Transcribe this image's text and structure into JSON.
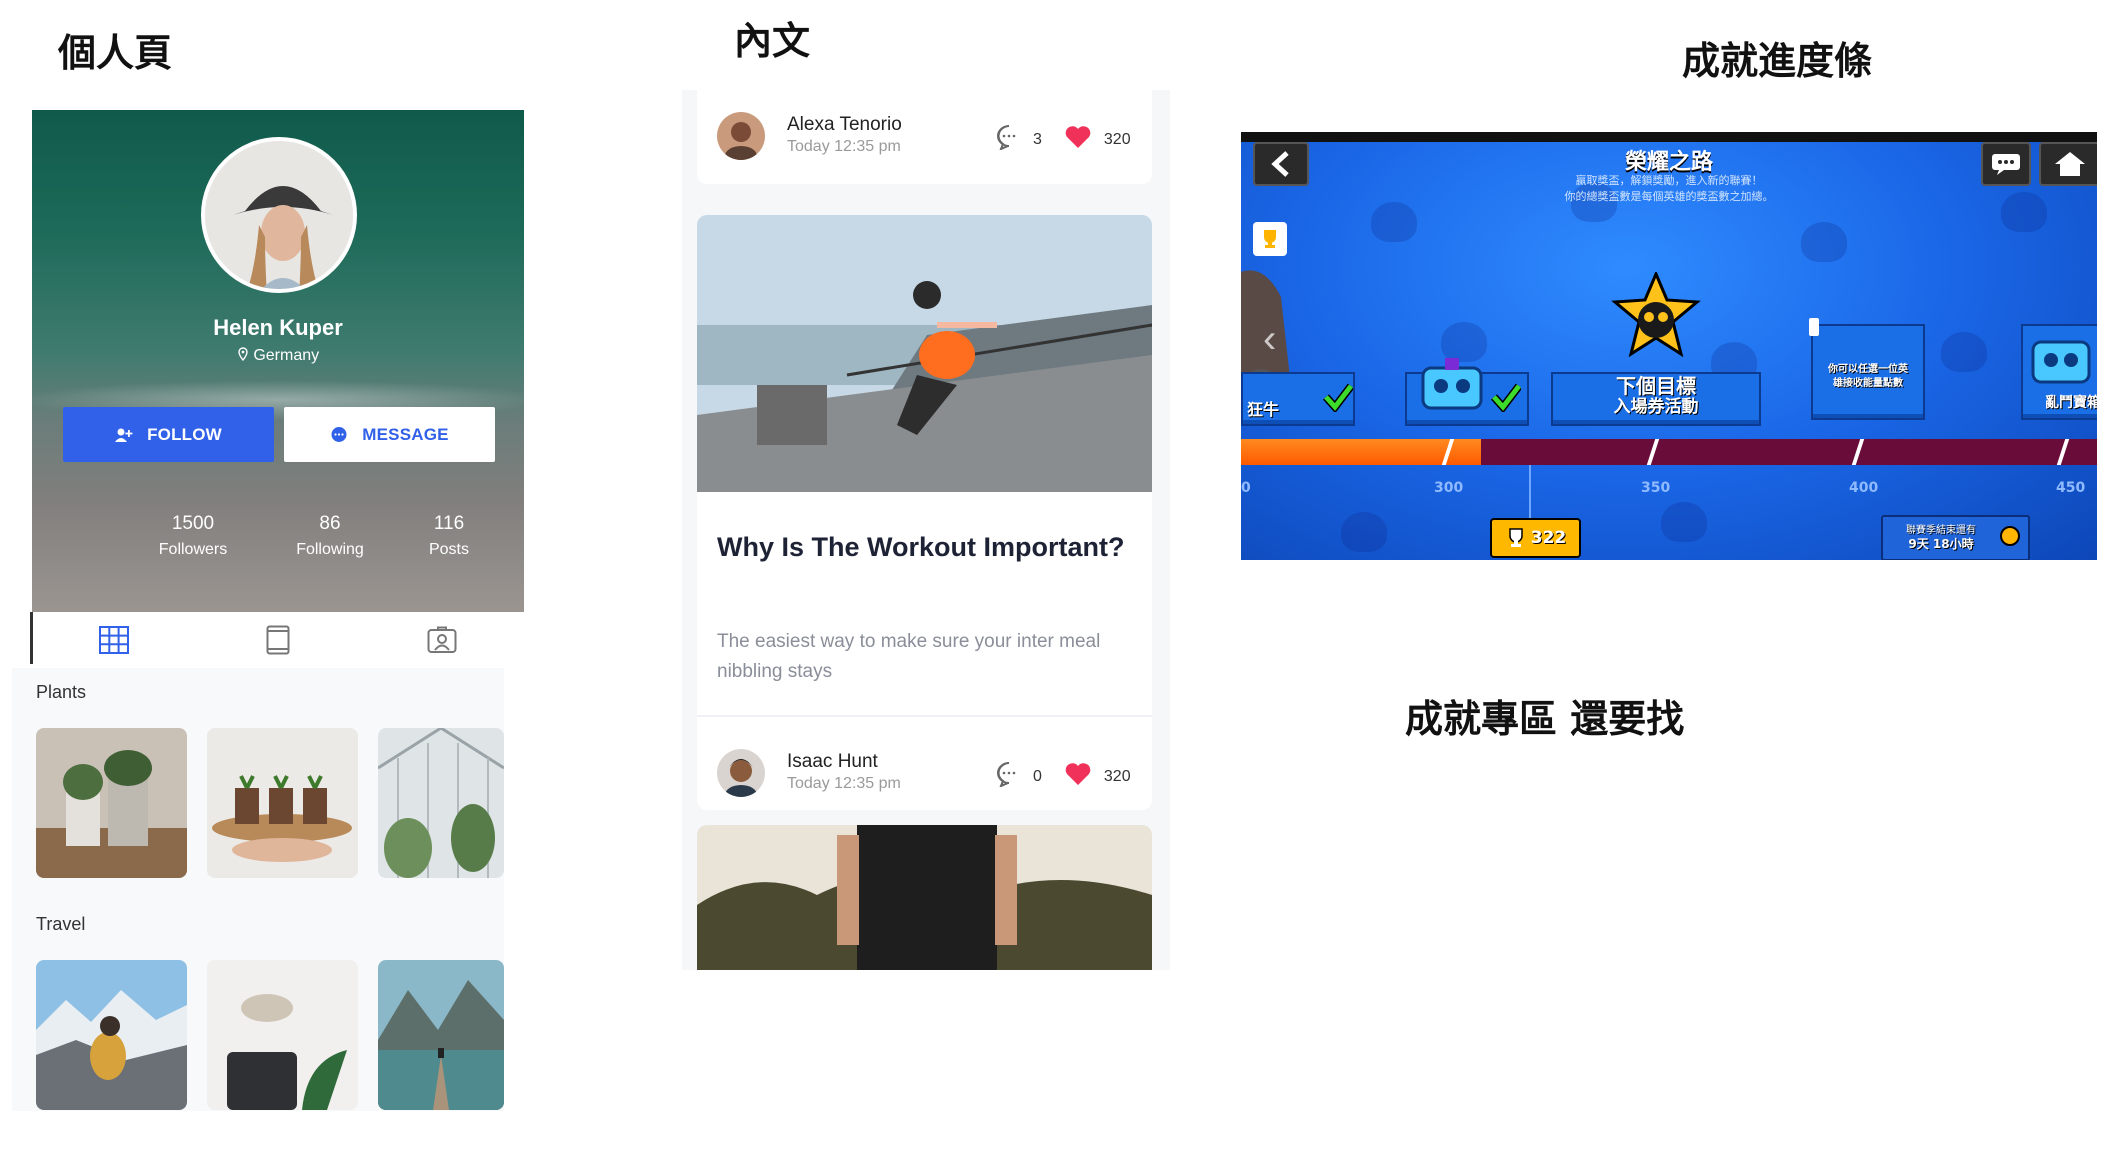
{
  "labels": {
    "profile": "個人頁",
    "content": "內文",
    "progress": "成就進度條",
    "todo": "成就專區 還要找"
  },
  "profile": {
    "name": "Helen Kuper",
    "location": "Germany",
    "follow_label": "FOLLOW",
    "message_label": "MESSAGE",
    "stats": [
      {
        "value": "1500",
        "label": "Followers"
      },
      {
        "value": "86",
        "label": "Following"
      },
      {
        "value": "116",
        "label": "Posts"
      }
    ],
    "tabs": [
      "grid-icon",
      "tablet-icon",
      "contact-card-icon"
    ],
    "categories": [
      {
        "title": "Plants"
      },
      {
        "title": "Travel"
      }
    ],
    "colors": {
      "accent": "#3161e8"
    }
  },
  "feed": {
    "posts": [
      {
        "author": "Alexa Tenorio",
        "time": "Today 12:35 pm",
        "comments": "3",
        "likes": "320"
      },
      {
        "author": "Isaac Hunt",
        "time": "Today 12:35 pm",
        "comments": "0",
        "likes": "320"
      }
    ],
    "article": {
      "title": "Why Is The Workout Important?",
      "excerpt": "The easiest way to make sure your inter meal nibbling stays"
    },
    "colors": {
      "heart": "#f0325a"
    }
  },
  "game": {
    "title": "榮耀之路",
    "subtitle_1": "贏取獎盃，解鎖獎勵，進入新的聯賽！",
    "subtitle_2": "你的總獎盃數是每個英雄的獎盃數之加總。",
    "rewards": [
      {
        "label": "狂牛"
      },
      {
        "label": ""
      },
      {
        "label_1": "下個目標",
        "label_2": "入場券活動"
      },
      {
        "label_1": "你可以任選一位英",
        "label_2": "雄接收能量點數"
      },
      {
        "label": "亂鬥寶箱"
      }
    ],
    "ticks": [
      "0",
      "300",
      "350",
      "400",
      "450"
    ],
    "trophies": "322",
    "progress_fraction": 0.28,
    "season": {
      "line_1": "聯賽季結束還有",
      "line_2": "9天 18小時"
    }
  }
}
